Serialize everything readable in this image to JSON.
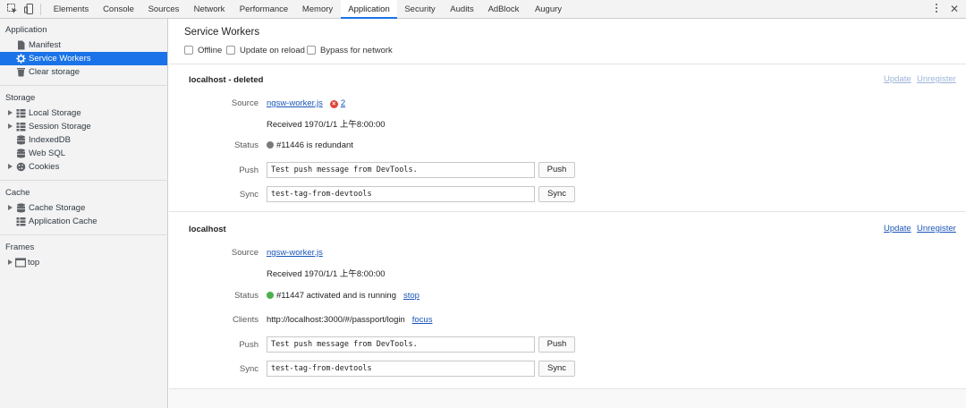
{
  "toolbar": {
    "tabs": [
      "Elements",
      "Console",
      "Sources",
      "Network",
      "Performance",
      "Memory",
      "Application",
      "Security",
      "Audits",
      "AdBlock",
      "Augury"
    ],
    "active_tab": "Application"
  },
  "sidebar": {
    "sections": {
      "application": {
        "title": "Application",
        "items": [
          "Manifest",
          "Service Workers",
          "Clear storage"
        ]
      },
      "storage": {
        "title": "Storage",
        "items": [
          "Local Storage",
          "Session Storage",
          "IndexedDB",
          "Web SQL",
          "Cookies"
        ]
      },
      "cache": {
        "title": "Cache",
        "items": [
          "Cache Storage",
          "Application Cache"
        ]
      },
      "frames": {
        "title": "Frames",
        "items": [
          "top"
        ]
      }
    },
    "selected_item": "Service Workers"
  },
  "main": {
    "title": "Service Workers",
    "options": [
      "Offline",
      "Update on reload",
      "Bypass for network"
    ],
    "labels": {
      "source": "Source",
      "status": "Status",
      "clients": "Clients",
      "push": "Push",
      "sync": "Sync",
      "push_button": "Push",
      "sync_button": "Sync",
      "update": "Update",
      "unregister": "Unregister"
    },
    "workers": [
      {
        "scope": "localhost - deleted",
        "source_file": "ngsw-worker.js",
        "error_count": "2",
        "received": "Received 1970/1/1 上午8:00:00",
        "status_text": "#11446 is redundant",
        "push_value": "Test push message from DevTools.",
        "sync_value": "test-tag-from-devtools"
      },
      {
        "scope": "localhost",
        "source_file": "ngsw-worker.js",
        "received": "Received 1970/1/1 上午8:00:00",
        "status_text": "#11447 activated and is running",
        "status_action": "stop",
        "clients_url": "http://localhost:3000/#/passport/login",
        "clients_action": "focus",
        "push_value": "Test push message from DevTools.",
        "sync_value": "test-tag-from-devtools"
      }
    ]
  },
  "colors": {
    "accent": "#1a73e8",
    "link": "#1a56b8",
    "link_disabled": "#9db4d8",
    "status_redundant": "#7a7a7a",
    "status_running": "#4caf50",
    "error": "#e0463a"
  },
  "icons": [
    "inspect-element-icon",
    "device-toolbar-icon",
    "manifest-icon",
    "gear-icon",
    "trash-icon",
    "grid-icon",
    "database-icon",
    "cookie-icon",
    "frame-icon",
    "error-icon",
    "status-dot-icon",
    "kebab-menu-icon",
    "close-icon"
  ]
}
